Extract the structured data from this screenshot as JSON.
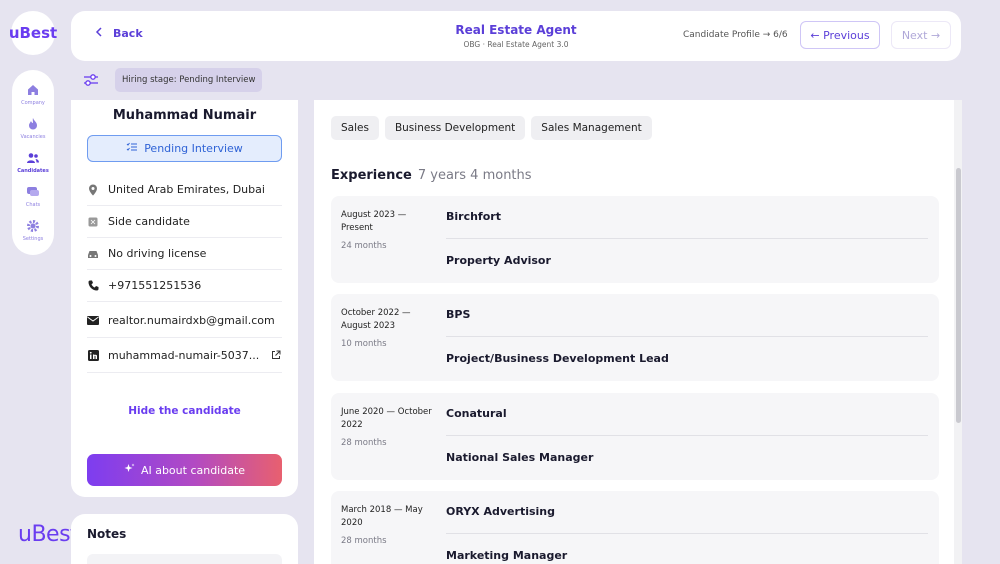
{
  "brand": {
    "logo_text": "uBest",
    "accent": "#6a3df0"
  },
  "sidebar": {
    "items": [
      {
        "label": "Company",
        "icon": "home-icon"
      },
      {
        "label": "Vacancies",
        "icon": "flame-icon"
      },
      {
        "label": "Candidates",
        "icon": "users-icon"
      },
      {
        "label": "Chats",
        "icon": "chat-icon"
      },
      {
        "label": "Settings",
        "icon": "gear-icon"
      }
    ]
  },
  "header": {
    "back_label": "Back",
    "title": "Real Estate Agent",
    "subtitle": "OBG · Real Estate Agent 3.0",
    "progress": "Candidate Profile → 6/6",
    "previous_label": "← Previous",
    "next_label": "Next →"
  },
  "stage": {
    "label": "Hiring stage: Pending Interview"
  },
  "profile": {
    "name": "Muhammad Numair",
    "status": "Pending Interview",
    "location": "United Arab Emirates, Dubai",
    "candidate_type": "Side candidate",
    "driving": "No driving license",
    "phone": "+971551251536",
    "email": "realtor.numairdxb@gmail.com",
    "linkedin": "muhammad-numair-5037...",
    "hide_label": "Hide the candidate",
    "ai_label": "AI about candidate"
  },
  "notes": {
    "title": "Notes"
  },
  "skills": [
    "Sales",
    "Business Development",
    "Sales Management"
  ],
  "experience": {
    "title": "Experience",
    "total": "7 years 4 months",
    "items": [
      {
        "date": "August 2023 — Present",
        "months": "24 months",
        "company": "Birchfort",
        "role": "Property Advisor"
      },
      {
        "date": "October 2022 — August 2023",
        "months": "10 months",
        "company": "BPS",
        "role": "Project/Business Development Lead"
      },
      {
        "date": "June 2020 — October 2022",
        "months": "28 months",
        "company": "Conatural",
        "role": "National Sales Manager"
      },
      {
        "date": "March 2018 — May 2020",
        "months": "28 months",
        "company": "ORYX Advertising",
        "role": "Marketing Manager"
      }
    ]
  }
}
